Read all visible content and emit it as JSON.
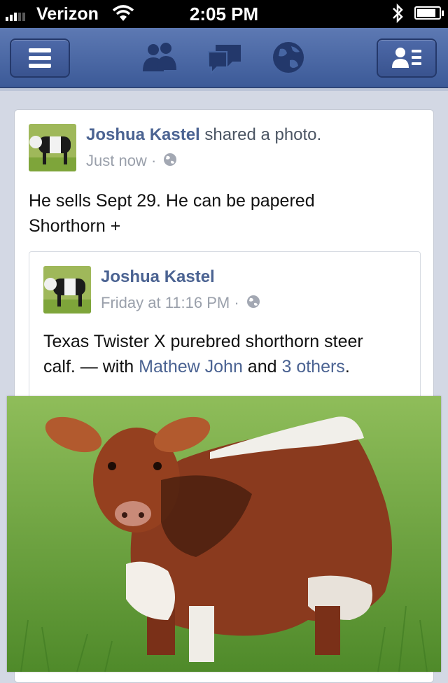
{
  "status_bar": {
    "carrier": "Verizon",
    "time": "2:05 PM",
    "signal_bars": 3,
    "battery_level": 0.85
  },
  "nav_bar": {
    "left_button": "menu-icon",
    "center_icons": [
      "friend-requests-icon",
      "messages-icon",
      "notifications-globe-icon"
    ],
    "right_button": "friends-list-icon"
  },
  "post": {
    "author": "Joshua Kastel",
    "action": " shared a photo.",
    "time": "Just now",
    "separator": "·",
    "text_line1": "He sells Sept 29.  He can be papered",
    "text_line2": "Shorthorn +",
    "shared": {
      "author": "Joshua Kastel",
      "time": "Friday at 11:16 PM",
      "separator": "·",
      "text_line1": "Texas Twister X purebred shorthorn steer",
      "text_line2_prefix": "calf. — with ",
      "tag1": "Mathew John",
      "and": " and ",
      "tag2": "3 others",
      "end": "."
    }
  },
  "colors": {
    "nav_bar": "#3c5a98",
    "link": "#4b6392",
    "feed_background": "#d3d8e4"
  }
}
